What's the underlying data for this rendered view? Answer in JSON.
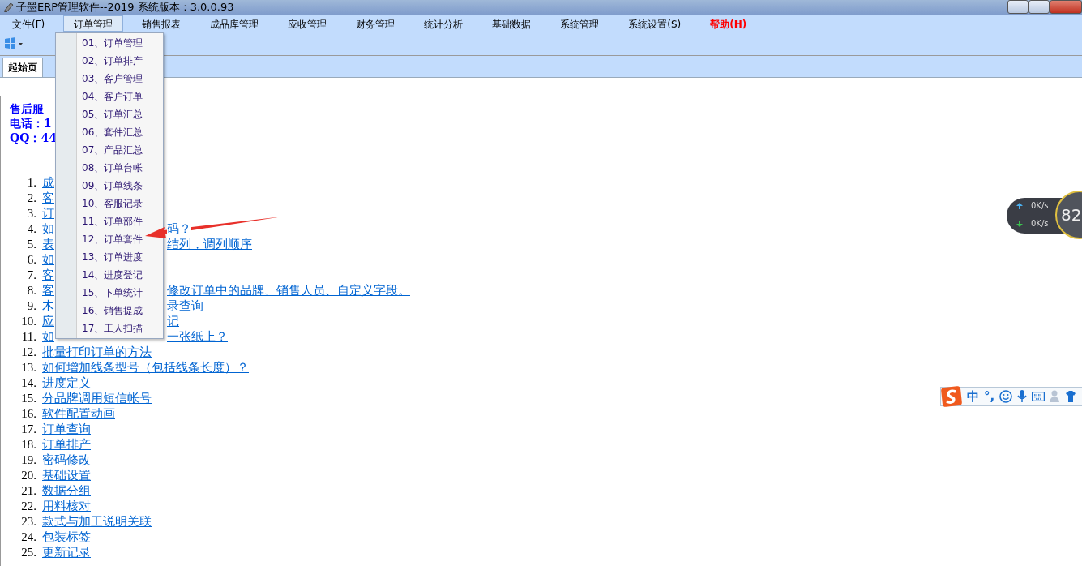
{
  "window": {
    "title": "子墨ERP管理软件--2019 系统版本：3.0.0.93"
  },
  "menubar": [
    {
      "label": "文件(F)",
      "selected": false,
      "kind": "normal"
    },
    {
      "label": "订单管理",
      "selected": true,
      "kind": "normal"
    },
    {
      "label": "销售报表",
      "selected": false,
      "kind": "normal"
    },
    {
      "label": "成品库管理",
      "selected": false,
      "kind": "normal"
    },
    {
      "label": "应收管理",
      "selected": false,
      "kind": "normal"
    },
    {
      "label": "财务管理",
      "selected": false,
      "kind": "normal"
    },
    {
      "label": "统计分析",
      "selected": false,
      "kind": "normal"
    },
    {
      "label": "基础数据",
      "selected": false,
      "kind": "normal"
    },
    {
      "label": "系统管理",
      "selected": false,
      "kind": "normal"
    },
    {
      "label": "系统设置(S)",
      "selected": false,
      "kind": "normal"
    },
    {
      "label": "帮助(H)",
      "selected": false,
      "kind": "help"
    }
  ],
  "tabs": [
    {
      "label": "起始页",
      "selected": true
    }
  ],
  "dropdown": [
    "01、订单管理",
    "02、订单排产",
    "03、客户管理",
    "04、客户订单",
    "05、订单汇总",
    "06、套件汇总",
    "07、产品汇总",
    "08、订单台帐",
    "09、订单线条",
    "10、客服记录",
    "11、订单部件",
    "12、订单套件",
    "13、订单进度",
    "14、进度登记",
    "15、下单统计",
    "16、销售提成",
    "17、工人扫描"
  ],
  "contact": [
    "售后服",
    "电话：1",
    "QQ：44"
  ],
  "help_links": [
    {
      "number": "1.",
      "lead": "成"
    },
    {
      "number": "2.",
      "lead": "客"
    },
    {
      "number": "3.",
      "lead": "订"
    },
    {
      "number": "4.",
      "lead": "如",
      "tail": "码？"
    },
    {
      "number": "5.",
      "lead": "表",
      "tail": "结列，调列顺序"
    },
    {
      "number": "6.",
      "lead": "如"
    },
    {
      "number": "7.",
      "lead": "客"
    },
    {
      "number": "8.",
      "lead": "客",
      "tail": "修改订单中的品牌、销售人员、自定义字段。"
    },
    {
      "number": "9.",
      "lead": "木",
      "tail": "录查询"
    },
    {
      "number": "10.",
      "lead": "应",
      "tail": "记"
    },
    {
      "number": "11.",
      "lead": "如",
      "tail": "一张纸上？"
    },
    {
      "number": "12.",
      "lead": "批量打印订单的方法"
    },
    {
      "number": "13.",
      "lead": "如何增加线条型号（包括线条长度）？"
    },
    {
      "number": "14.",
      "lead": "进度定义"
    },
    {
      "number": "15.",
      "lead": "分品牌调用短信帐号"
    },
    {
      "number": "16.",
      "lead": "软件配置动画"
    },
    {
      "number": "17.",
      "lead": "订单查询"
    },
    {
      "number": "18.",
      "lead": "订单排产"
    },
    {
      "number": "19.",
      "lead": "密码修改"
    },
    {
      "number": "20.",
      "lead": "基础设置"
    },
    {
      "number": "21.",
      "lead": "数据分组"
    },
    {
      "number": "22.",
      "lead": "用料核对"
    },
    {
      "number": "23.",
      "lead": "款式与加工说明关联"
    },
    {
      "number": "24.",
      "lead": "包装标签"
    },
    {
      "number": "25.",
      "lead": "更新记录"
    }
  ],
  "speed_widget": {
    "upload": "0K/s",
    "download": "0K/s",
    "gauge": "82"
  },
  "ime_toolbar": {
    "mode": "中",
    "punct": "°,"
  }
}
